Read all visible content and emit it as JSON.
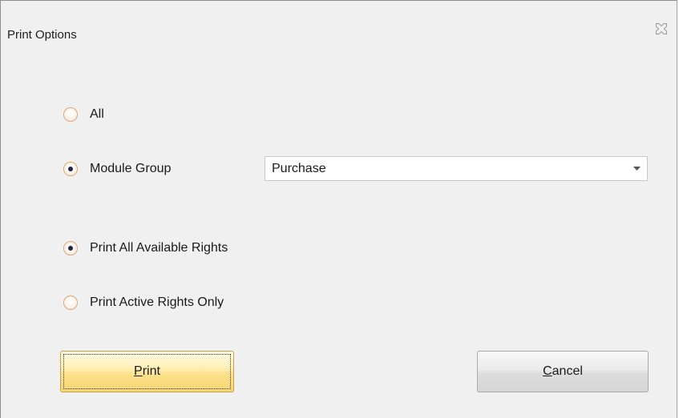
{
  "dialog": {
    "title": "Print Options",
    "close_icon": "close-icon"
  },
  "scope": {
    "all_label": "All",
    "all_checked": false,
    "module_group_label": "Module Group",
    "module_group_checked": true,
    "module_group_value": "Purchase"
  },
  "rights": {
    "all_available_label": "Print All Available Rights",
    "all_available_checked": true,
    "active_only_label": "Print Active Rights Only",
    "active_only_checked": false
  },
  "buttons": {
    "print_mnemonic": "P",
    "print_rest": "rint",
    "cancel_mnemonic": "C",
    "cancel_rest": "ancel"
  },
  "colors": {
    "accent_button": "#fbdf86",
    "radio_border": "#d8a77a"
  }
}
